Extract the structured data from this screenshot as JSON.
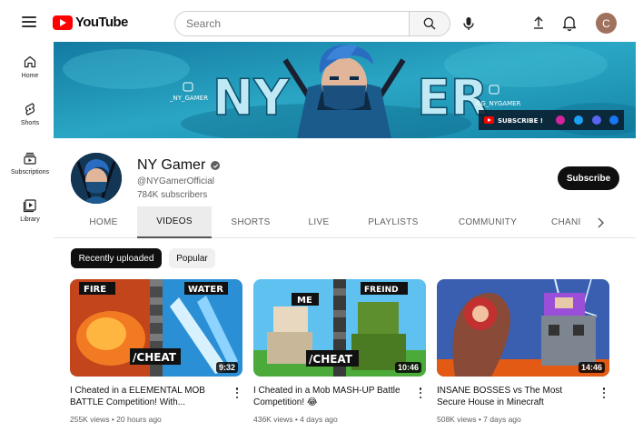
{
  "header": {
    "logo_text": "YouTube",
    "search_placeholder": "Search",
    "user_initial": "C"
  },
  "nav": {
    "items": [
      {
        "label": "Home",
        "icon": "home-icon"
      },
      {
        "label": "Shorts",
        "icon": "shorts-icon"
      },
      {
        "label": "Subscriptions",
        "icon": "subscriptions-icon"
      },
      {
        "label": "Library",
        "icon": "library-icon"
      }
    ]
  },
  "banner": {
    "title": "NY GAMER",
    "handle_left": "_NY_GAMER",
    "handle_right": "GG_NYGAMER",
    "subscribe_label": "SUBSCRIBE !"
  },
  "channel": {
    "name": "NY Gamer",
    "handle": "@NYGamerOfficial",
    "subscribers": "784K subscribers",
    "subscribe_label": "Subscribe"
  },
  "tabs": [
    {
      "label": "HOME",
      "active": false
    },
    {
      "label": "VIDEOS",
      "active": true
    },
    {
      "label": "SHORTS",
      "active": false
    },
    {
      "label": "LIVE",
      "active": false
    },
    {
      "label": "PLAYLISTS",
      "active": false
    },
    {
      "label": "COMMUNITY",
      "active": false
    },
    {
      "label": "CHANI",
      "active": false
    }
  ],
  "chips": [
    {
      "label": "Recently uploaded",
      "active": true
    },
    {
      "label": "Popular",
      "active": false
    }
  ],
  "videos": [
    {
      "title": "I Cheated in a ELEMENTAL MOB BATTLE Competition! With...",
      "meta": "255K views • 20 hours ago",
      "duration": "9:32",
      "thumb_texts": [
        "FIRE",
        "WATER",
        "/CHEAT"
      ]
    },
    {
      "title": "I Cheated in a Mob MASH-UP Battle Competition! 😂",
      "meta": "436K views • 4 days ago",
      "duration": "10:46",
      "thumb_texts": [
        "ME",
        "FREIND",
        "/CHEAT"
      ]
    },
    {
      "title": "INSANE BOSSES vs The Most Secure House in Minecraft",
      "meta": "508K views • 7 days ago",
      "duration": "14:46",
      "thumb_texts": []
    }
  ],
  "colors": {
    "youtube_red": "#ff0000",
    "banner_teal": "#1a7fa0",
    "text_primary": "#0f0f0f",
    "text_secondary": "#606060"
  }
}
